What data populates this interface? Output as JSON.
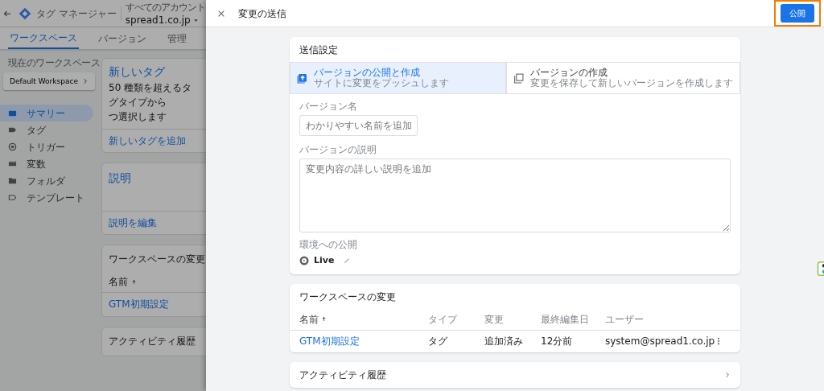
{
  "background": {
    "app_name": "タグ マネージャー",
    "breadcrumb": "すべてのアカウント",
    "account": "spread1.co.jp",
    "tabs": [
      {
        "label": "ワークスペース",
        "selected": true
      },
      {
        "label": "バージョン",
        "selected": false
      },
      {
        "label": "管理",
        "selected": false
      }
    ],
    "workspace_label": "現在のワークスペース",
    "workspace": "Default Workspace",
    "nav": [
      {
        "label": "サマリー",
        "selected": true
      },
      {
        "label": "タグ",
        "selected": false
      },
      {
        "label": "トリガー",
        "selected": false
      },
      {
        "label": "変数",
        "selected": false
      },
      {
        "label": "フォルダ",
        "selected": false
      },
      {
        "label": "テンプレート",
        "selected": false
      }
    ],
    "new_tag_card": {
      "title": "新しいタグ",
      "description_lines": [
        "50 種類を超えるタグタイプから",
        "つ選択します"
      ],
      "link": "新しいタグを追加"
    },
    "description_card": {
      "title": "説明",
      "link": "説明を編集"
    },
    "changes_card": {
      "title": "ワークスペースの変更",
      "column": "名前",
      "row": "GTM初期設定"
    },
    "activity_card": {
      "title": "アクティビティ履歴"
    }
  },
  "panel": {
    "title": "変更の送信",
    "publish_button": "公開",
    "settings": {
      "title": "送信設定",
      "options": [
        {
          "title": "バージョンの公開と作成",
          "subtitle": "サイトに変更をプッシュします",
          "selected": true
        },
        {
          "title": "バージョンの作成",
          "subtitle": "変更を保存して新しいバージョンを作成します",
          "selected": false
        }
      ],
      "name_label": "バージョン名",
      "name_placeholder": "わかりやすい名前を追加",
      "desc_label": "バージョンの説明",
      "desc_placeholder": "変更内容の詳しい説明を追加",
      "env_label": "環境への公開",
      "env": "Live"
    },
    "changes": {
      "title": "ワークスペースの変更",
      "columns": [
        "名前",
        "タイプ",
        "変更",
        "最終編集日",
        "ユーザー"
      ],
      "rows": [
        {
          "cells": [
            "GTM初期設定",
            "タグ",
            "追加済み",
            "12分前",
            "system@spread1.co.jp"
          ]
        }
      ]
    },
    "activity": {
      "title": "アクティビティ履歴"
    }
  }
}
